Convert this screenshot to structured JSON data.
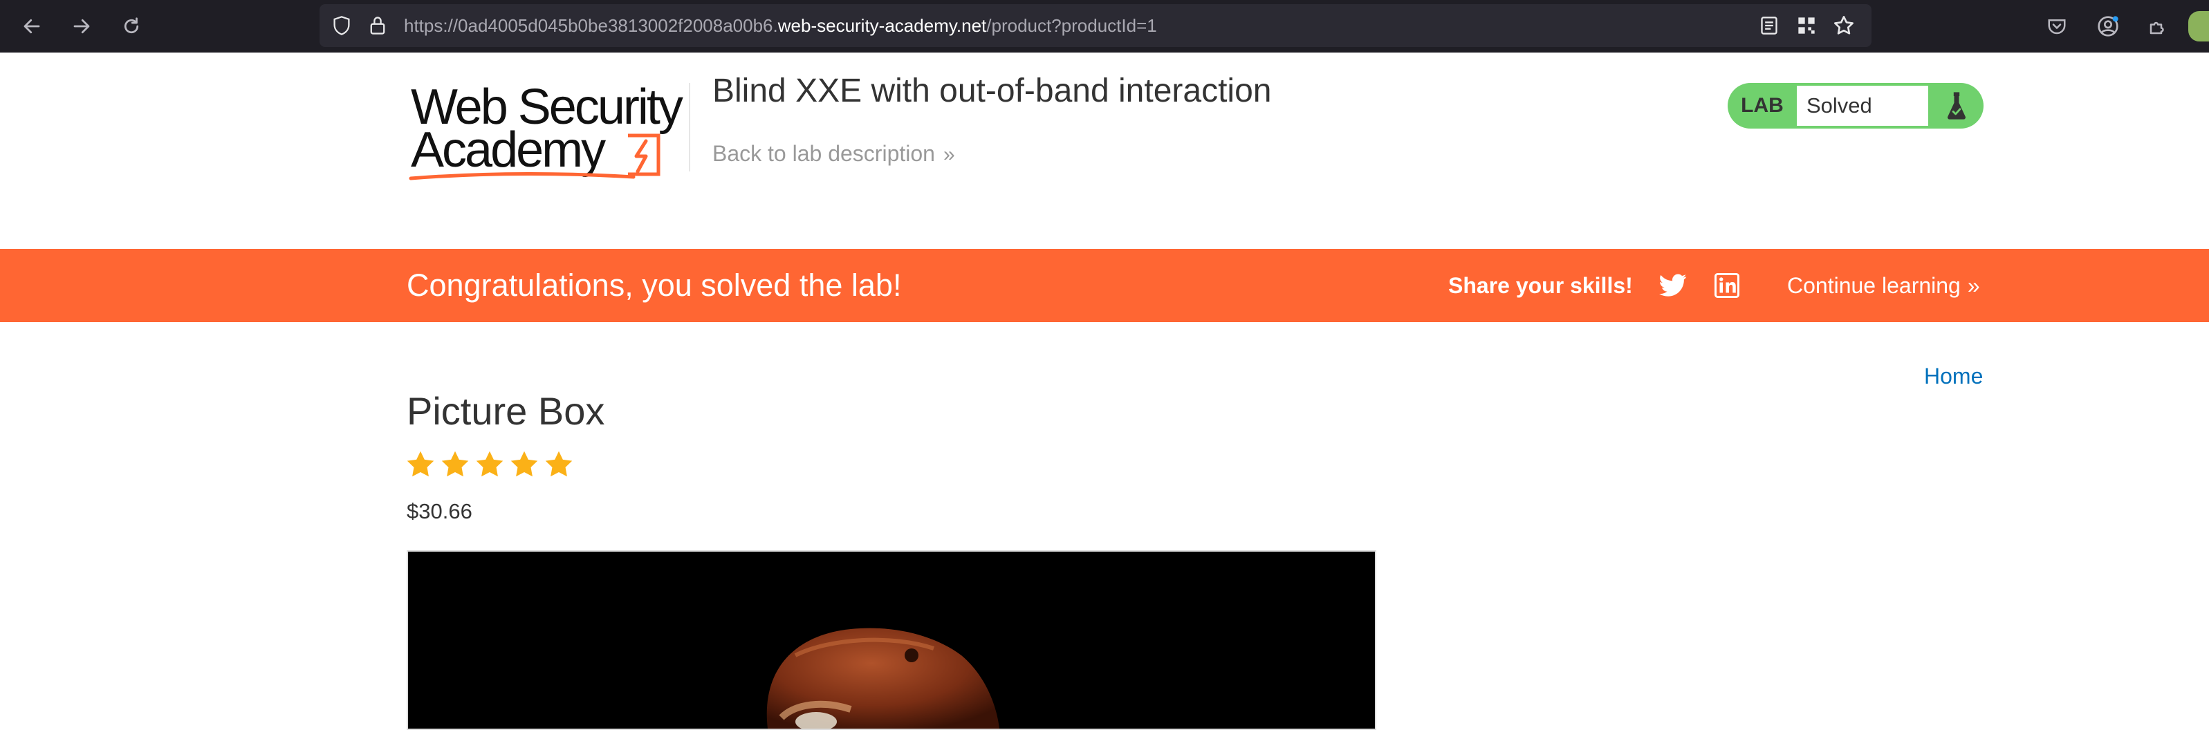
{
  "browser": {
    "url_prefix": "https://0ad4005d045b0be3813002f2008a00b6.",
    "url_host": "web-security-academy.net",
    "url_path": "/product?productId=1",
    "icons": [
      "back-arrow-icon",
      "forward-arrow-icon",
      "reload-icon",
      "shield-icon",
      "lock-icon",
      "reader-mode-icon",
      "qr-grid-icon",
      "star-bookmark-icon",
      "pocket-icon",
      "account-icon",
      "extensions-icon"
    ]
  },
  "header": {
    "logo_line1": "Web Security",
    "logo_line2": "Academy",
    "lab_title": "Blind XXE with out-of-band interaction",
    "back_link": "Back to lab description",
    "back_chevron": "»"
  },
  "lab_badge": {
    "tag": "LAB",
    "status": "Solved",
    "icon": "flask-icon",
    "color": "#70d16d"
  },
  "banner": {
    "message": "Congratulations, you solved the lab!",
    "share_label": "Share your skills!",
    "continue_label": "Continue learning",
    "continue_chevron": "»",
    "color": "#ff6633",
    "icons": [
      "twitter-icon",
      "linkedin-icon"
    ]
  },
  "nav": {
    "home": "Home"
  },
  "product": {
    "title": "Picture Box",
    "rating": 5,
    "rating_max": 5,
    "price": "$30.66"
  }
}
